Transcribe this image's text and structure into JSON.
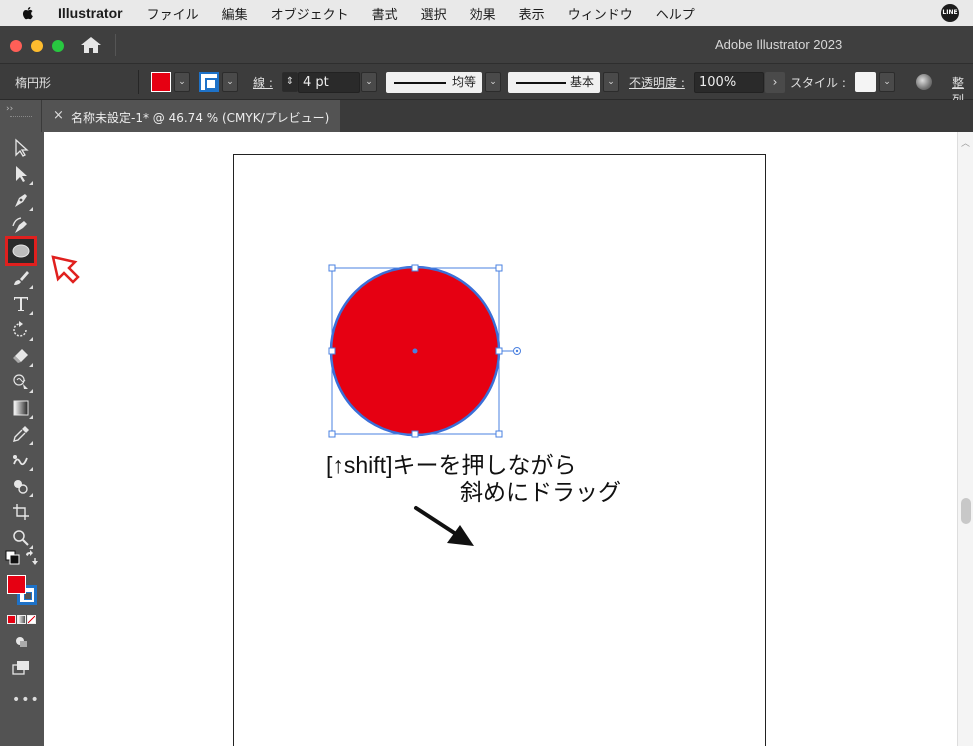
{
  "menubar": {
    "app_name": "Illustrator",
    "items": [
      "ファイル",
      "編集",
      "オブジェクト",
      "書式",
      "選択",
      "効果",
      "表示",
      "ウィンドウ",
      "ヘルプ"
    ],
    "tray_icon": "LINE"
  },
  "window": {
    "title": "Adobe Illustrator 2023"
  },
  "control_bar": {
    "tool_name": "楕円形",
    "stroke_label": "線 :",
    "stroke_weight": "4 pt",
    "stroke_profile_label": "均等",
    "brush_label": "基本",
    "opacity_label": "不透明度 :",
    "opacity_value": "100%",
    "style_label": "スタイル :",
    "align_label": "整列",
    "fill_color": "#e60012",
    "stroke_color": "#1e72c8"
  },
  "document_tab": {
    "close": "×",
    "title": "名称未設定-1* @ 46.74 % (CMYK/プレビュー)"
  },
  "toolbar": {
    "tools": [
      "selection-tool",
      "direct-selection-tool",
      "pen-tool",
      "curvature-tool",
      "ellipse-tool",
      "paintbrush-tool",
      "type-tool",
      "rotate-tool",
      "eraser-tool",
      "warp-tool",
      "gradient-tool",
      "eyedropper-tool",
      "blend-tool",
      "shape-builder-tool",
      "artboard-tool",
      "zoom-tool"
    ],
    "active_tool": "ellipse-tool",
    "more": "•••"
  },
  "canvas": {
    "shape": {
      "type": "circle",
      "fill": "#e60012",
      "stroke": "#3a6fd8",
      "selected": true
    },
    "annotation_line1": "[↑shift]キーを押しながら",
    "annotation_line2": "斜めにドラッグ",
    "highlight_color": "#e0201e"
  }
}
